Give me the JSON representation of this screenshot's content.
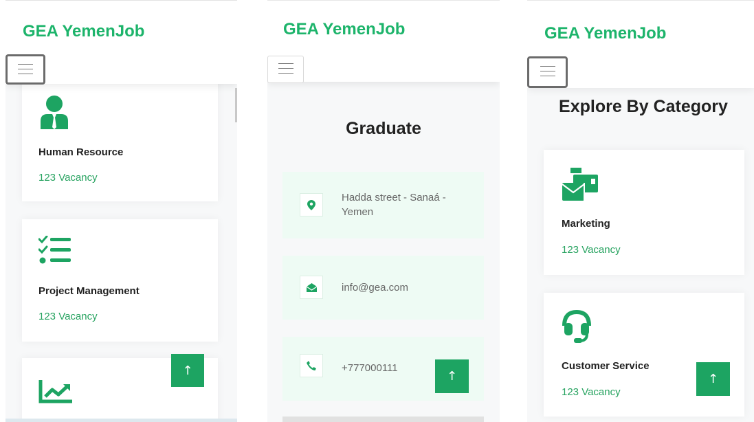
{
  "brand": "GEA YemenJob",
  "accent_color": "#1db46b",
  "panels": {
    "left": {
      "cards": [
        {
          "icon": "user-tie-icon",
          "title": "Human Resource",
          "vacancy": "123 Vacancy"
        },
        {
          "icon": "task-list-icon",
          "title": "Project Management",
          "vacancy": "123 Vacancy"
        },
        {
          "icon": "chart-line-icon",
          "title": "",
          "vacancy": ""
        }
      ]
    },
    "middle": {
      "heading": "Graduate",
      "contacts": [
        {
          "icon": "map-marker-icon",
          "text": "Hadda street - Sanaá - Yemen"
        },
        {
          "icon": "envelope-open-icon",
          "text": "info@gea.com"
        },
        {
          "icon": "phone-icon",
          "text": "+777000111"
        }
      ]
    },
    "right": {
      "heading": "Explore By Category",
      "cards": [
        {
          "icon": "mail-bulk-icon",
          "title": "Marketing",
          "vacancy": "123 Vacancy"
        },
        {
          "icon": "headset-icon",
          "title": "Customer Service",
          "vacancy": "123 Vacancy"
        }
      ]
    }
  },
  "back_to_top_glyph": "↑"
}
